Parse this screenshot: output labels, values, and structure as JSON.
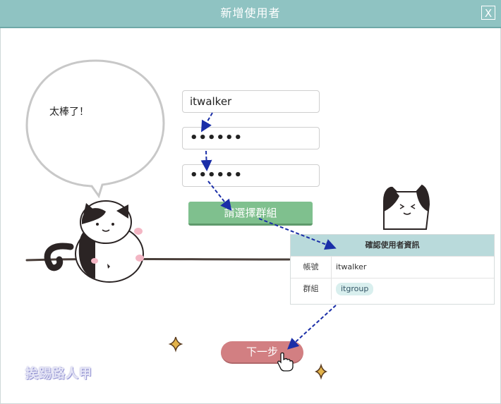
{
  "window": {
    "title": "新增使用者",
    "close_label": "X"
  },
  "form": {
    "username_value": "itwalker",
    "password_value": "••••••",
    "confirm_password_value": "••••••",
    "select_group_label": "請選擇群組",
    "next_label": "下一步"
  },
  "confirm_card": {
    "title": "確認使用者資訊",
    "rows": [
      {
        "label": "帳號",
        "value": "itwalker"
      },
      {
        "label": "群組",
        "value": "itgroup"
      }
    ]
  },
  "speech_bubble": {
    "text": "太棒了！"
  },
  "watermark": {
    "text": "挨踢路人甲"
  },
  "colors": {
    "titlebar": "#8fc3c2",
    "group_button": "#7fc08e",
    "next_button": "#d27f82",
    "card_header": "#b9dadb",
    "arrow": "#1a2ea8"
  }
}
